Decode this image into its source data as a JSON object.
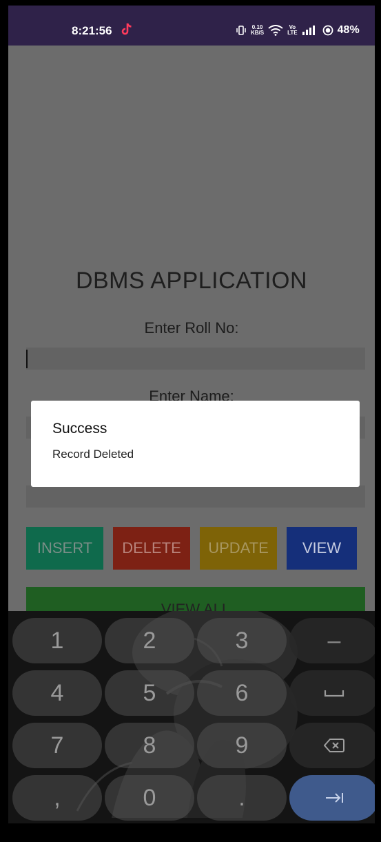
{
  "status_bar": {
    "time": "8:21:56",
    "net_speed_value": "0.10",
    "net_speed_unit": "KB/S",
    "volte_top": "Vo",
    "volte_bottom": "LTE",
    "battery": "48%"
  },
  "app": {
    "title": "DBMS APPLICATION",
    "roll_label": "Enter Roll No:",
    "name_label": "Enter Name:",
    "buttons": {
      "insert": "INSERT",
      "delete": "DELETE",
      "update": "UPDATE",
      "view": "VIEW",
      "view_all": "VIEW ALL"
    },
    "colors": {
      "insert": "#1abc8b",
      "delete": "#d93a22",
      "update": "#e0ad0c",
      "view": "#2450d8",
      "view_all": "#37a83b"
    }
  },
  "dialog": {
    "title": "Success",
    "message": "Record Deleted"
  },
  "keyboard": {
    "rows": [
      [
        "1",
        "2",
        "3",
        "–"
      ],
      [
        "4",
        "5",
        "6",
        "space-icon"
      ],
      [
        "7",
        "8",
        "9",
        "backspace-icon"
      ],
      [
        ",",
        "0",
        ".",
        "tab-next-icon"
      ]
    ]
  }
}
